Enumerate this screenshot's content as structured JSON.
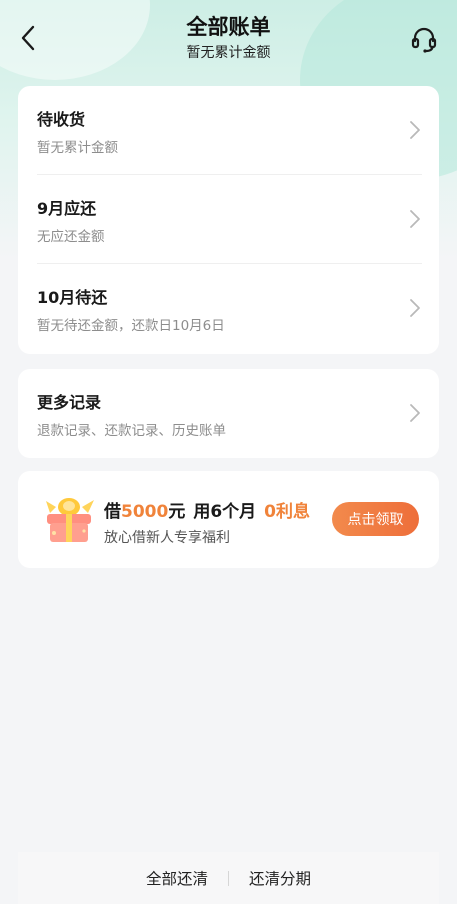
{
  "header": {
    "title": "全部账单",
    "subtitle": "暂无累计金额"
  },
  "bill_items": [
    {
      "label": "待收货",
      "sub": "暂无累计金额"
    },
    {
      "label": "9月应还",
      "sub": "无应还金额"
    },
    {
      "label": "10月待还",
      "sub": "暂无待还金额，还款日10月6日"
    }
  ],
  "records": {
    "label": "更多记录",
    "sub": "退款记录、还款记录、历史账单"
  },
  "promo": {
    "prefix": "借",
    "amount": "5000",
    "unit": "元",
    "term": "用6个月",
    "interest": "0利息",
    "subtitle": "放心借新人专享福利",
    "button": "点击领取"
  },
  "bottom_bar": {
    "pay_all": "全部还清",
    "installment": "还清分期"
  },
  "colors": {
    "accent": "#f0833a",
    "header_bg": "#cdeee5",
    "page_bg": "#f4f5f7"
  },
  "icons": {
    "back": "chevron-left-icon",
    "service": "headset-icon",
    "row_arrow": "chevron-right-icon",
    "promo": "gift-box-icon"
  }
}
